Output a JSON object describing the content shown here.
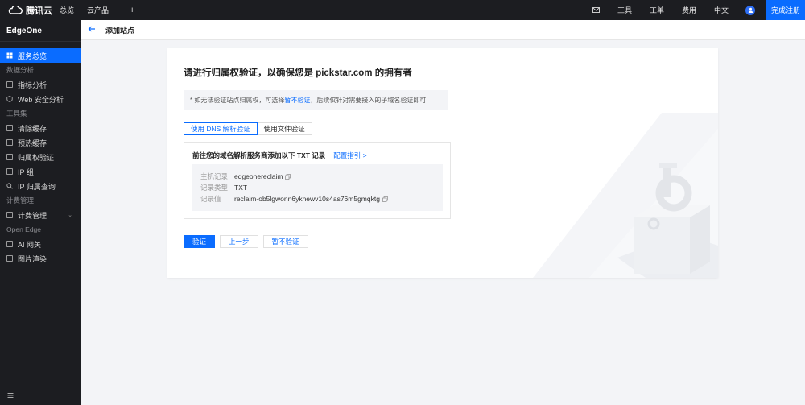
{
  "topbar": {
    "logo_text": "腾讯云",
    "nav": [
      "总览",
      "云产品"
    ],
    "plus": "+",
    "right_items": [
      "工具",
      "工单",
      "费用",
      "中文"
    ],
    "register_label": "完成注册"
  },
  "sidebar": {
    "product_name": "EdgeOne",
    "items": [
      {
        "type": "item",
        "label": "服务总览",
        "icon": "grid-icon",
        "active": true
      },
      {
        "type": "group",
        "label": "数据分析"
      },
      {
        "type": "item",
        "label": "指标分析",
        "icon": "chart-icon"
      },
      {
        "type": "item",
        "label": "Web 安全分析",
        "icon": "shield-icon"
      },
      {
        "type": "group",
        "label": "工具集"
      },
      {
        "type": "item",
        "label": "清除缓存",
        "icon": "clear-icon"
      },
      {
        "type": "item",
        "label": "预热缓存",
        "icon": "preheat-icon"
      },
      {
        "type": "item",
        "label": "归属权验证",
        "icon": "verify-icon"
      },
      {
        "type": "item",
        "label": "IP 组",
        "icon": "ip-group-icon"
      },
      {
        "type": "item",
        "label": "IP 归属查询",
        "icon": "search-icon"
      },
      {
        "type": "group",
        "label": "计费管理"
      },
      {
        "type": "item",
        "label": "计费管理",
        "icon": "billing-icon",
        "expand": true
      },
      {
        "type": "group",
        "label": "Open Edge"
      },
      {
        "type": "item",
        "label": "AI 网关",
        "icon": "ai-gateway-icon"
      },
      {
        "type": "item",
        "label": "图片渲染",
        "icon": "image-icon"
      }
    ]
  },
  "header": {
    "title": "添加站点"
  },
  "card": {
    "title": "请进行归属权验证，以确保您是 pickstar.com 的拥有者",
    "notice_prefix": "* 如无法验证站点归属权，可选择",
    "notice_link": "暂不验证",
    "notice_suffix": "，后续仅针对需要接入的子域名验证即可",
    "tabs": [
      "使用 DNS 解析验证",
      "使用文件验证"
    ],
    "record_title": "前往您的域名解析服务商添加以下 TXT 记录",
    "record_guide": "配置指引 >",
    "records": [
      {
        "key": "主机记录",
        "value": "edgeonereclaim",
        "copy": true
      },
      {
        "key": "记录类型",
        "value": "TXT",
        "copy": false
      },
      {
        "key": "记录值",
        "value": "reclaim-ob5lgwonn6yknewv10s4as76m5gmqktg",
        "copy": true
      }
    ],
    "buttons": {
      "verify": "验证",
      "prev": "上一步",
      "skip": "暂不验证"
    }
  },
  "colors": {
    "accent": "#0a6cff",
    "topbar_bg": "#1c1d21"
  }
}
